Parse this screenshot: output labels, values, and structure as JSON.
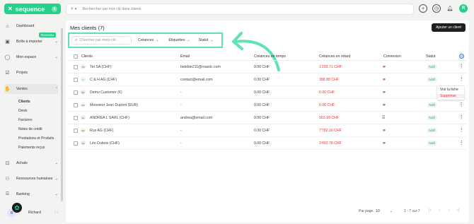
{
  "app": {
    "brand": "sequence",
    "brand_badge": "8"
  },
  "topbar": {
    "search_placeholder": "Rechercher par mot-clé dans clients",
    "icons": [
      "plus-icon",
      "clock-icon",
      "bell-icon",
      "avatar"
    ],
    "avatar_letter": "R"
  },
  "sidebar": {
    "items": [
      {
        "label": "Dashboard",
        "icon": "home-icon"
      },
      {
        "label": "Boîte à importer",
        "icon": "inbox-icon",
        "badge": "Nouveau"
      },
      {
        "label": "Mon espace",
        "icon": "user-icon"
      },
      {
        "label": "Projets",
        "icon": "check-square-icon"
      },
      {
        "label": "Ventes",
        "icon": "hand-money-icon"
      },
      {
        "label": "Achats",
        "icon": "bag-icon"
      },
      {
        "label": "Ressources humaines",
        "icon": "people-icon"
      },
      {
        "label": "Banking",
        "icon": "bank-icon"
      }
    ],
    "ventes_sub": [
      "Clients",
      "Devis",
      "Factures",
      "Notes de crédit",
      "Prestations et Produits",
      "Paiements reçus"
    ],
    "user": {
      "name": "Richard",
      "initials": "R",
      "notif": "11"
    }
  },
  "main": {
    "title": "Mes clients (7)",
    "add_button": "Ajouter un client",
    "filter_placeholder": "Chercher par mots-clé",
    "filters": [
      "Créances",
      "Étiquettes",
      "Statut"
    ],
    "columns": [
      "Clients",
      "Email",
      "Créances en temps",
      "Créances en retard",
      "Connexion",
      "Statut"
    ],
    "rows": [
      {
        "initials": "TS",
        "name": "Tet SA (CHF)",
        "email": "bidebie211@roastic.com",
        "en_temps": "0.00 CHF",
        "retard": "1'233.71 CHF",
        "connexion": "broken",
        "statut": "Actif"
      },
      {
        "initials": "C",
        "name": "C & H AG (CHF)",
        "email": "contact@email.com",
        "en_temps": "0.00 CHF",
        "retard": "388.88 CHF",
        "connexion": "broken",
        "statut": "Actif"
      },
      {
        "initials": "DC",
        "name": "Demo Customer (€)",
        "email": "-",
        "en_temps": "0.00 CHF",
        "retard": "0.00 CHF",
        "connexion": "broken",
        "statut": ""
      },
      {
        "initials": "MJ",
        "name": "Monsieur Jean Dupont (EUR)",
        "email": "-",
        "en_temps": "0.00 CHF",
        "retard": "0.00 CHF",
        "connexion": "broken",
        "statut": "Actif"
      },
      {
        "initials": "AL",
        "name": "ANDREA L SARL (CHF)",
        "email": "andrea@email.com",
        "en_temps": "0.00 CHF",
        "retard": "563.18 CHF",
        "connexion": "connected",
        "statut": "Actif"
      },
      {
        "initials": "RA",
        "name": "Rus AG (CHF)",
        "email": "-",
        "en_temps": "0.00 CHF",
        "retard": "7'782.16 CHF",
        "connexion": "broken",
        "statut": "Actif"
      },
      {
        "initials": "LD",
        "name": "Léo Dubois (CHF)",
        "email": "-",
        "en_temps": "0.00 CHF",
        "retard": "3'492.78 CHF",
        "connexion": "broken",
        "statut": "Actif"
      }
    ],
    "context_menu": {
      "view": "Voir la fiche",
      "delete": "Supprimer"
    },
    "pagination": {
      "per_page_label": "Par page",
      "per_page": "10",
      "range": "1 - 7 sur 7"
    }
  }
}
